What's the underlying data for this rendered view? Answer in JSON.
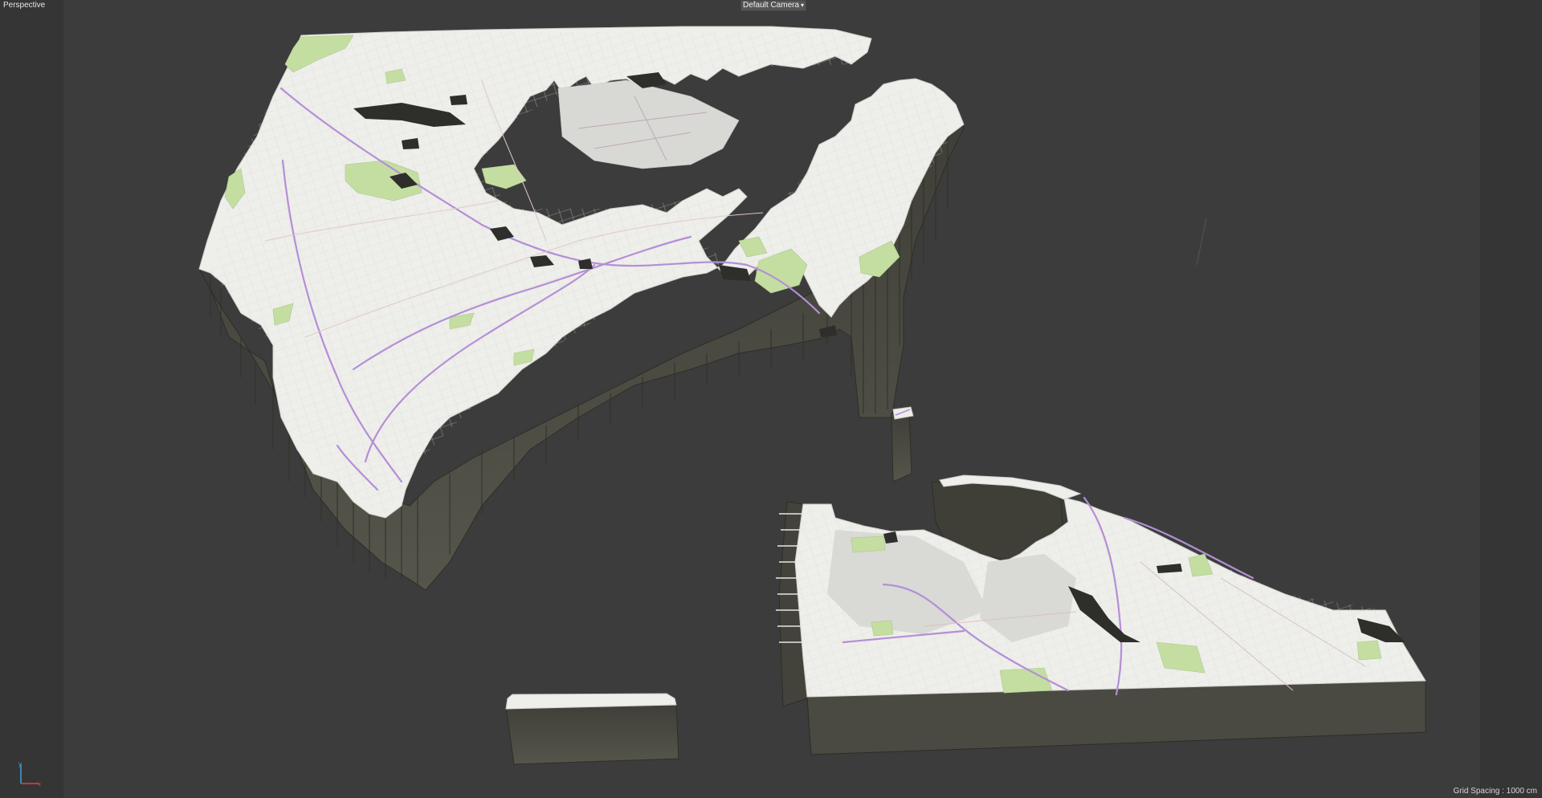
{
  "viewport": {
    "view_label": "Perspective",
    "camera_label": "Default Camera",
    "camera_menu_glyph": "▾",
    "grid_label": "Grid Spacing : 1000 cm"
  },
  "axis_gizmo": {
    "y_label": "y",
    "x_label": "x"
  },
  "colors": {
    "background": "#3c3c3c",
    "map_surface": "#eeeeeb",
    "extrusion_side": "#4b4b43",
    "park_green": "#c4dea2",
    "road_purple": "#b48fd6",
    "axis_y": "#3fa0d8",
    "axis_x": "#d84a3a"
  }
}
